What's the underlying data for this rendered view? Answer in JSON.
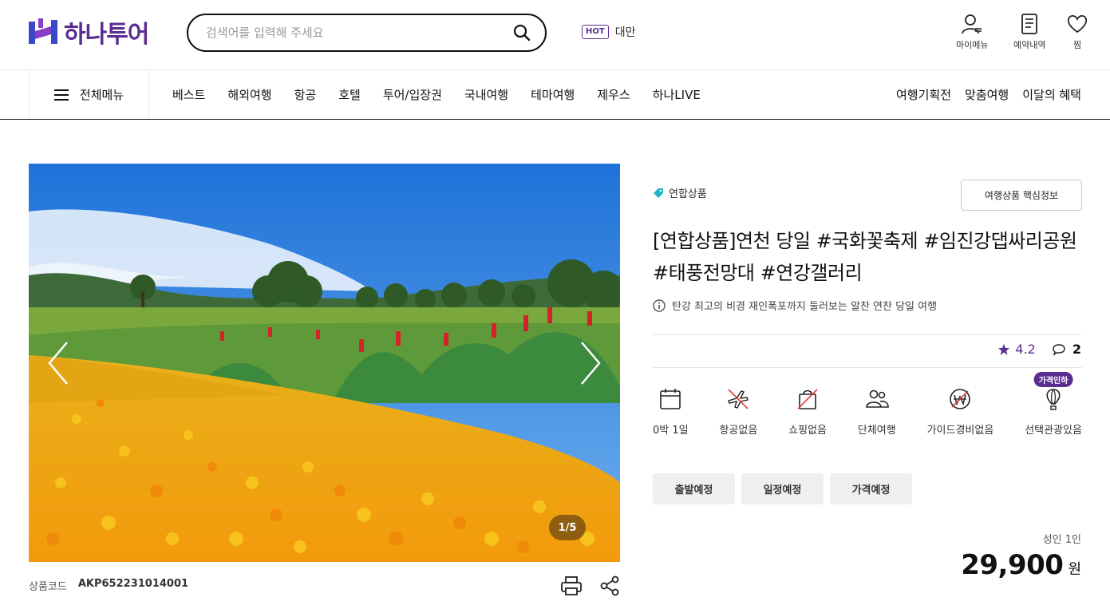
{
  "header": {
    "logo_text": "하나투어",
    "search": {
      "placeholder": "검색어를 입력해 주세요",
      "value": ""
    },
    "hot": {
      "badge": "HOT",
      "keyword": "대만"
    },
    "utils": [
      {
        "label": "마이메뉴",
        "icon": "user-icon"
      },
      {
        "label": "예약내역",
        "icon": "document-icon"
      },
      {
        "label": "찜",
        "icon": "heart-icon"
      }
    ]
  },
  "gnb": {
    "all_menu": "전체메뉴",
    "items": [
      "베스트",
      "해외여행",
      "항공",
      "호텔",
      "투어/입장권",
      "국내여행",
      "테마여행",
      "제우스",
      "하나LIVE"
    ],
    "right_items": [
      "여행기획전",
      "맞춤여행",
      "이달의 혜택"
    ]
  },
  "gallery": {
    "counter": "1/5"
  },
  "product": {
    "code_label": "상품코드",
    "code_value": "AKP652231014001",
    "tag": "연합상품",
    "key_info_button": "여행상품 핵심정보",
    "title": "[연합상품]연천 당일 #국화꽃축제 #임진강댑싸리공원 #태풍전망대 #연강갤러리",
    "subtitle": "탄강 최고의 비경 재인폭포까지 둘러보는 알찬 연찬 당일 여행",
    "rating": "4.2",
    "review_count": "2",
    "features": [
      {
        "label": "0박 1일",
        "icon": "calendar-icon"
      },
      {
        "label": "항공없음",
        "icon": "no-flight-icon"
      },
      {
        "label": "쇼핑없음",
        "icon": "no-shopping-icon"
      },
      {
        "label": "단체여행",
        "icon": "group-icon"
      },
      {
        "label": "가이드경비없음",
        "icon": "no-guide-fee-icon"
      },
      {
        "label": "선택관광있음",
        "icon": "balloon-icon",
        "badge": "가격인하"
      }
    ],
    "schedule_tabs": [
      "출발예정",
      "일정예정",
      "가격예정"
    ],
    "per_person": "성인 1인",
    "price": "29,900",
    "currency": "원"
  },
  "colors": {
    "brand": "#5c2d91",
    "tag": "#1fb6c9"
  }
}
